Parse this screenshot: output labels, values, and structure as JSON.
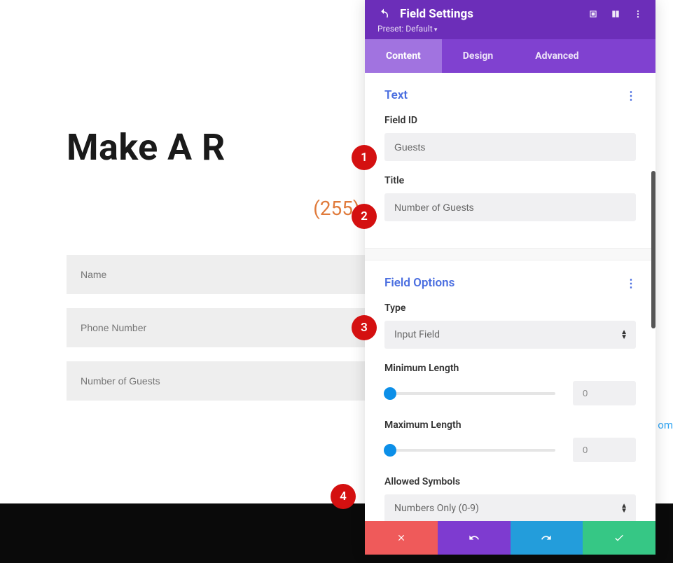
{
  "page": {
    "heading": "Make A R",
    "phone": "(255)",
    "fields": [
      "Name",
      "Phone Number",
      "Number of Guests"
    ],
    "link_fragment": "om"
  },
  "panel": {
    "title": "Field Settings",
    "preset": "Preset: Default",
    "tabs": {
      "content": "Content",
      "design": "Design",
      "advanced": "Advanced"
    }
  },
  "text_section": {
    "title": "Text",
    "field_id_label": "Field ID",
    "field_id_value": "Guests",
    "title_label": "Title",
    "title_value": "Number of Guests"
  },
  "options_section": {
    "title": "Field Options",
    "type_label": "Type",
    "type_value": "Input Field",
    "min_label": "Minimum Length",
    "min_value": "0",
    "max_label": "Maximum Length",
    "max_value": "0",
    "symbols_label": "Allowed Symbols",
    "symbols_value": "Numbers Only (0-9)"
  },
  "badges": {
    "b1": "1",
    "b2": "2",
    "b3": "3",
    "b4": "4"
  }
}
